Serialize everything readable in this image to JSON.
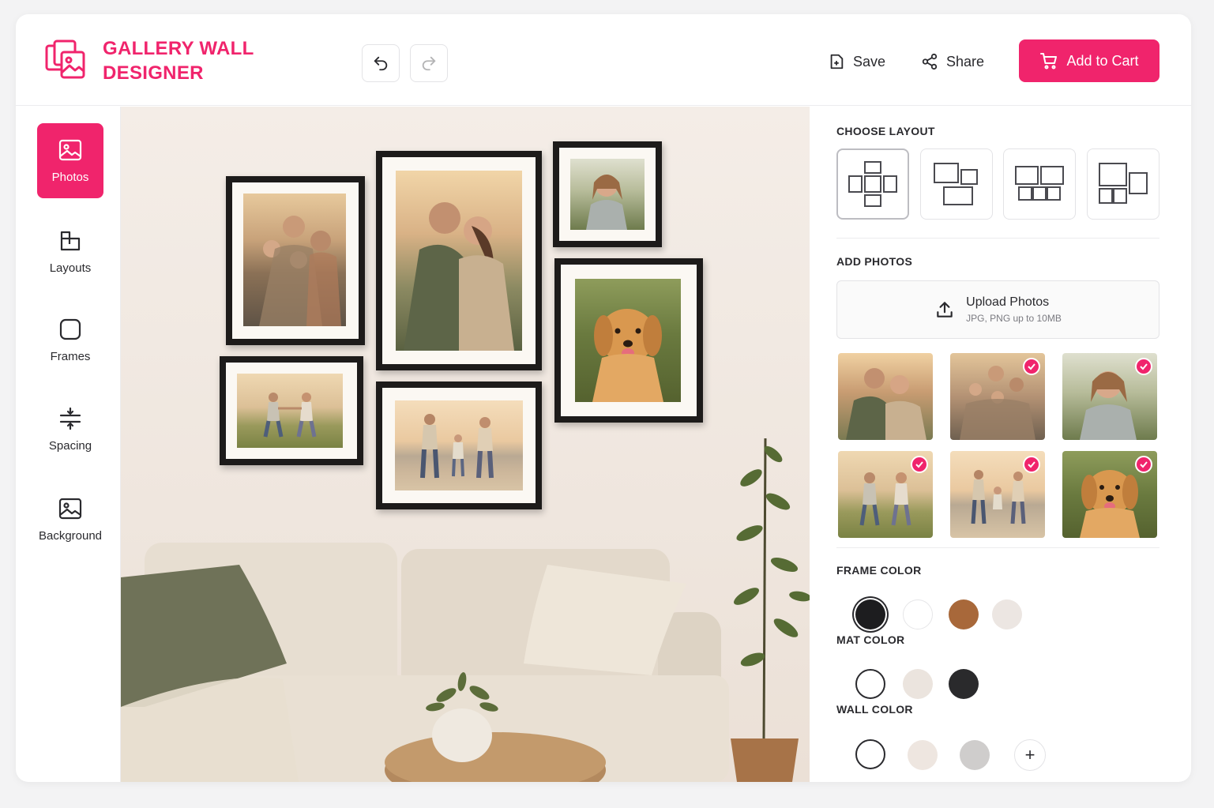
{
  "brand": {
    "title": "GALLERY WALL DESIGNER"
  },
  "header": {
    "save_label": "Save",
    "share_label": "Share",
    "cart_label": "Add to Cart"
  },
  "sidebar": {
    "items": [
      {
        "label": "Photos",
        "icon": "image-icon",
        "active": true
      },
      {
        "label": "Layouts",
        "icon": "layouts-icon"
      },
      {
        "label": "Frames",
        "icon": "frame-icon"
      },
      {
        "label": "Spacing",
        "icon": "spacing-icon"
      },
      {
        "label": "Background",
        "icon": "background-icon"
      }
    ]
  },
  "panel": {
    "layout_title": "CHOOSE LAYOUT",
    "add_photos_title": "ADD PHOTOS",
    "upload_label": "Upload Photos",
    "upload_hint": "JPG, PNG up to 10MB",
    "frame_color_title": "FRAME COLOR",
    "mat_color_title": "MAT COLOR",
    "wall_color_title": "WALL COLOR",
    "frame_colors": [
      "#1d1d1f",
      "#ffffff",
      "#a8683a",
      "#ece6e2"
    ],
    "mat_colors": [
      "#ffffff",
      "#ebe4de",
      "#2a2a2c"
    ],
    "wall_colors": [
      "#ffffff",
      "#eee6e0",
      "#cfcdcc"
    ],
    "add_color_label": "+"
  },
  "colors": {
    "accent": "#f0246c"
  }
}
